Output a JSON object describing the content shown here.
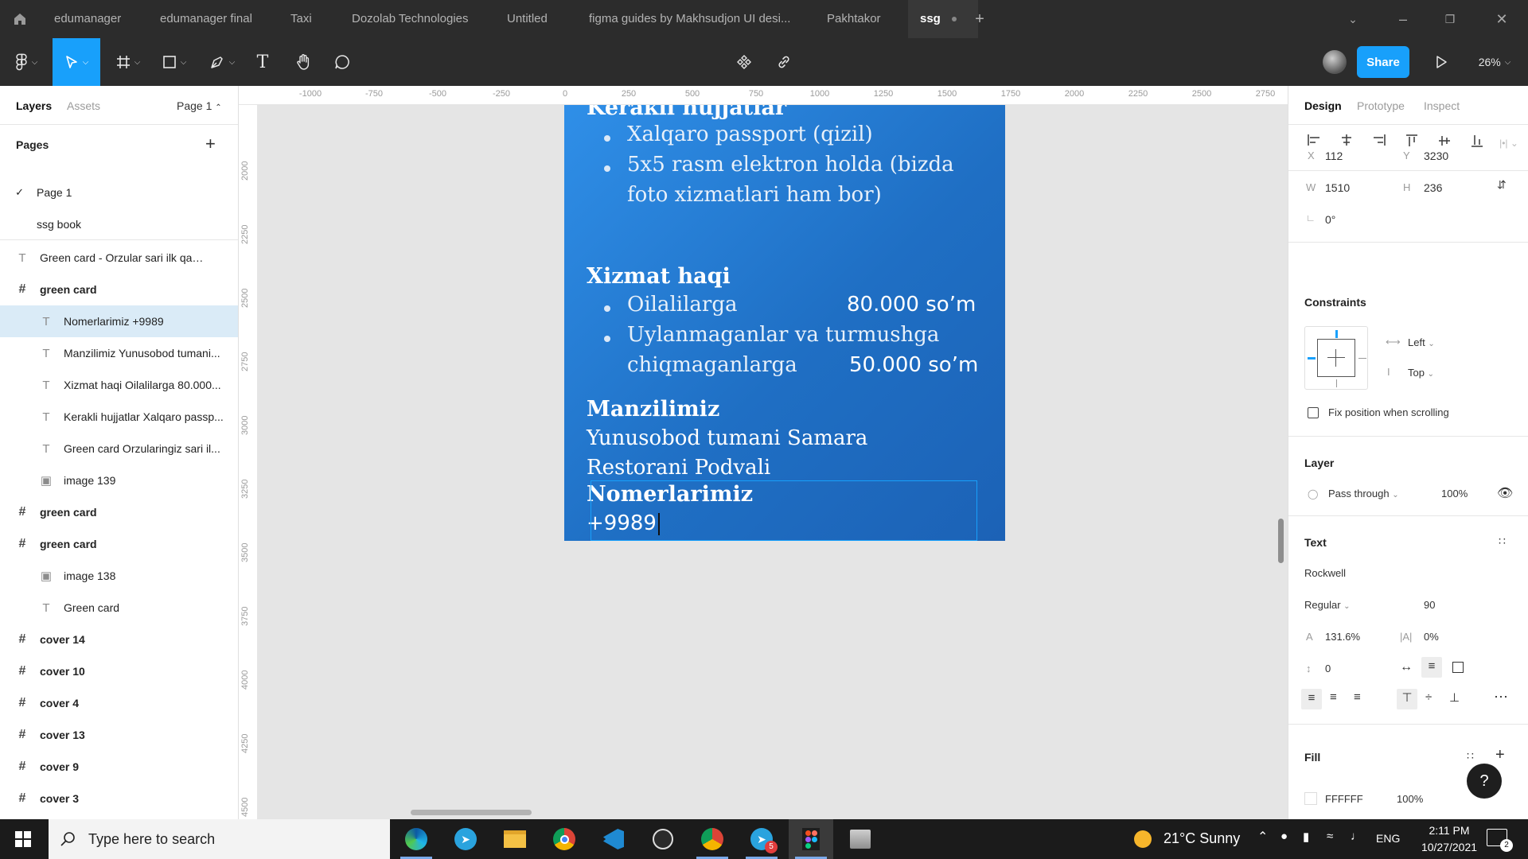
{
  "tabbar": {
    "home_icon": "home-icon",
    "tabs": [
      {
        "label": "edumanager"
      },
      {
        "label": "edumanager final"
      },
      {
        "label": "Taxi"
      },
      {
        "label": "Dozolab Technologies"
      },
      {
        "label": "Untitled"
      },
      {
        "label": "figma guides by Makhsudjon UI desi..."
      },
      {
        "label": "Pakhtakor"
      },
      {
        "label": "ssg"
      }
    ],
    "add_tab": "+"
  },
  "toolbar": {
    "share_label": "Share",
    "zoom": "26%"
  },
  "left_panel": {
    "tabs": {
      "layers": "Layers",
      "assets": "Assets"
    },
    "page_selector": "Page 1",
    "pages_title": "Pages",
    "pages": [
      {
        "label": "Page 1",
        "checked": true
      },
      {
        "label": "ssg book",
        "checked": false
      }
    ],
    "layers": [
      {
        "label": "Green card - Orzular sari ilk qadam",
        "type": "text",
        "indent": 0,
        "selected": false
      },
      {
        "label": "green card",
        "type": "frame",
        "indent": 0,
        "selected": false
      },
      {
        "label": "Nomerlarimiz +9989",
        "type": "text",
        "indent": 1,
        "selected": true
      },
      {
        "label": "Manzilimiz Yunusobod tumani...",
        "type": "text",
        "indent": 1,
        "selected": false
      },
      {
        "label": "Xizmat haqi Oilalilarga 80.000...",
        "type": "text",
        "indent": 1,
        "selected": false
      },
      {
        "label": "Kerakli hujjatlar Xalqaro passp...",
        "type": "text",
        "indent": 1,
        "selected": false
      },
      {
        "label": "Green card Orzularingiz sari il...",
        "type": "text",
        "indent": 1,
        "selected": false
      },
      {
        "label": "image 139",
        "type": "image",
        "indent": 1,
        "selected": false
      },
      {
        "label": "green card",
        "type": "frame",
        "indent": 0,
        "selected": false
      },
      {
        "label": "green card",
        "type": "frame",
        "indent": 0,
        "selected": false
      },
      {
        "label": "image 138",
        "type": "image",
        "indent": 1,
        "selected": false
      },
      {
        "label": "Green card",
        "type": "text",
        "indent": 1,
        "selected": false
      },
      {
        "label": "cover 14",
        "type": "frame",
        "indent": 0,
        "selected": false
      },
      {
        "label": "cover 10",
        "type": "frame",
        "indent": 0,
        "selected": false
      },
      {
        "label": "cover 4",
        "type": "frame",
        "indent": 0,
        "selected": false
      },
      {
        "label": "cover 13",
        "type": "frame",
        "indent": 0,
        "selected": false
      },
      {
        "label": "cover 9",
        "type": "frame",
        "indent": 0,
        "selected": false
      },
      {
        "label": "cover 3",
        "type": "frame",
        "indent": 0,
        "selected": false
      }
    ]
  },
  "rulers": {
    "top": [
      "-1000",
      "-750",
      "-500",
      "-250",
      "0",
      "250",
      "500",
      "750",
      "1000",
      "1250",
      "1500",
      "1750",
      "2000",
      "2250",
      "2500",
      "2750"
    ],
    "left": [
      "2000",
      "2250",
      "2500",
      "2750",
      "3000",
      "3250",
      "3500",
      "3750",
      "4000",
      "4250",
      "4500"
    ]
  },
  "card": {
    "heading_docs": "Kerakli hujjatlar",
    "docs_items": [
      "Xalqaro passport (qizil)",
      "5x5 rasm elektron holda (bizda",
      "foto xizmatlari ham bor)"
    ],
    "heading_fee": "Xizmat haqi",
    "fee_items": [
      {
        "label": "Oilalilarga",
        "price": "80.000 so’m"
      },
      {
        "label": "Uylanmaganlar va turmushga",
        "price": ""
      },
      {
        "label": "chiqmaganlarga",
        "price": "50.000 so’m"
      }
    ],
    "heading_address": "Manzilimiz",
    "address_lines": [
      " Yunusobod tumani Samara",
      "Restorani Podvali"
    ],
    "heading_phone": "Nomerlarimiz",
    "phone": " +9989"
  },
  "right_panel": {
    "tabs": {
      "design": "Design",
      "prototype": "Prototype",
      "inspect": "Inspect"
    },
    "x_label": "X",
    "x": "112",
    "y_label": "Y",
    "y": "3230",
    "w_label": "W",
    "w": "1510",
    "h_label": "H",
    "h": "236",
    "rotation": "0°",
    "constraints_title": "Constraints",
    "constraint_h": "Left",
    "constraint_v": "Top",
    "fix_scroll": "Fix position when scrolling",
    "layer_title": "Layer",
    "blend": "Pass through",
    "opacity": "100%",
    "text_title": "Text",
    "font": "Rockwell",
    "weight": "Regular",
    "size": "90",
    "line_height": "131.6%",
    "letter_spacing": "0%",
    "paragraph_spacing": "0",
    "fill_title": "Fill",
    "fill_hex": "FFFFFF",
    "fill_opacity": "100%",
    "help": "?"
  },
  "taskbar": {
    "search_placeholder": "Type here to search",
    "weather": "21°C  Sunny",
    "lang": "ENG",
    "time": "2:11 PM",
    "date": "10/27/2021",
    "telegram_badge": "5",
    "notif_badge": "2"
  },
  "colors": {
    "accent": "#18a0fb",
    "card_top": "#2f8fe8",
    "card_bottom": "#1c62b6",
    "selected_layer": "#daebf7"
  }
}
